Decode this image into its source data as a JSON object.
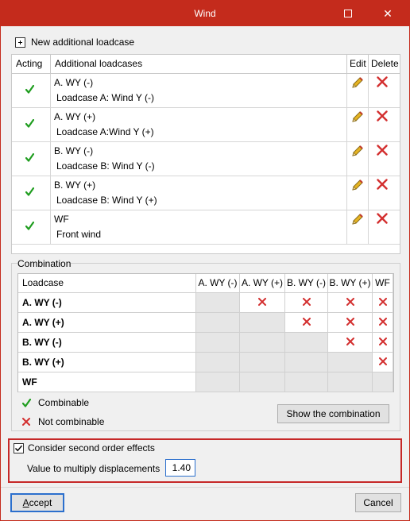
{
  "window": {
    "title": "Wind",
    "maximize_icon": "maximize-icon",
    "close_icon": "close-icon",
    "close_glyph": "✕",
    "titlebar_color": "#c42b1c"
  },
  "toolbar": {
    "new_loadcase_label": "New additional loadcase",
    "new_loadcase_icon": "add-icon"
  },
  "loadcases_table": {
    "headers": {
      "acting": "Acting",
      "name": "Additional loadcases",
      "edit": "Edit",
      "delete": "Delete"
    },
    "rows": [
      {
        "acting": true,
        "name": "A. WY (-)",
        "description": "Loadcase A: Wind Y (-)"
      },
      {
        "acting": true,
        "name": "A. WY (+)",
        "description": "Loadcase A:Wind Y (+)"
      },
      {
        "acting": true,
        "name": "B. WY (-)",
        "description": "Loadcase B: Wind Y (-)"
      },
      {
        "acting": true,
        "name": "B. WY (+)",
        "description": "Loadcase B: Wind Y (+)"
      },
      {
        "acting": true,
        "name": "WF",
        "description": "Front wind"
      }
    ]
  },
  "combination": {
    "group_title": "Combination",
    "corner_header": "Loadcase",
    "columns": [
      "A. WY (-)",
      "A. WY (+)",
      "B. WY (-)",
      "B. WY (+)",
      "WF"
    ],
    "rows": [
      {
        "label": "A. WY (-)",
        "not_combinable": [
          1,
          2,
          3,
          4
        ]
      },
      {
        "label": "A. WY (+)",
        "not_combinable": [
          2,
          3,
          4
        ]
      },
      {
        "label": "B. WY (-)",
        "not_combinable": [
          3,
          4
        ]
      },
      {
        "label": "B. WY (+)",
        "not_combinable": [
          4
        ]
      },
      {
        "label": "WF",
        "not_combinable": []
      }
    ],
    "legend": {
      "combinable": "Combinable",
      "not_combinable": "Not combinable"
    },
    "show_button": "Show the combination"
  },
  "second_order": {
    "checkbox_label": "Consider second order effects",
    "checked": true,
    "multiplier_label": "Value to multiply displacements",
    "multiplier_value": "1.40",
    "highlight_color": "#c62828"
  },
  "footer": {
    "accept_label": "Accept",
    "cancel_label": "Cancel"
  },
  "colors": {
    "check_green": "#1f9d1f",
    "delete_red": "#d32f2f",
    "pencil_yellow": "#e6b422"
  }
}
